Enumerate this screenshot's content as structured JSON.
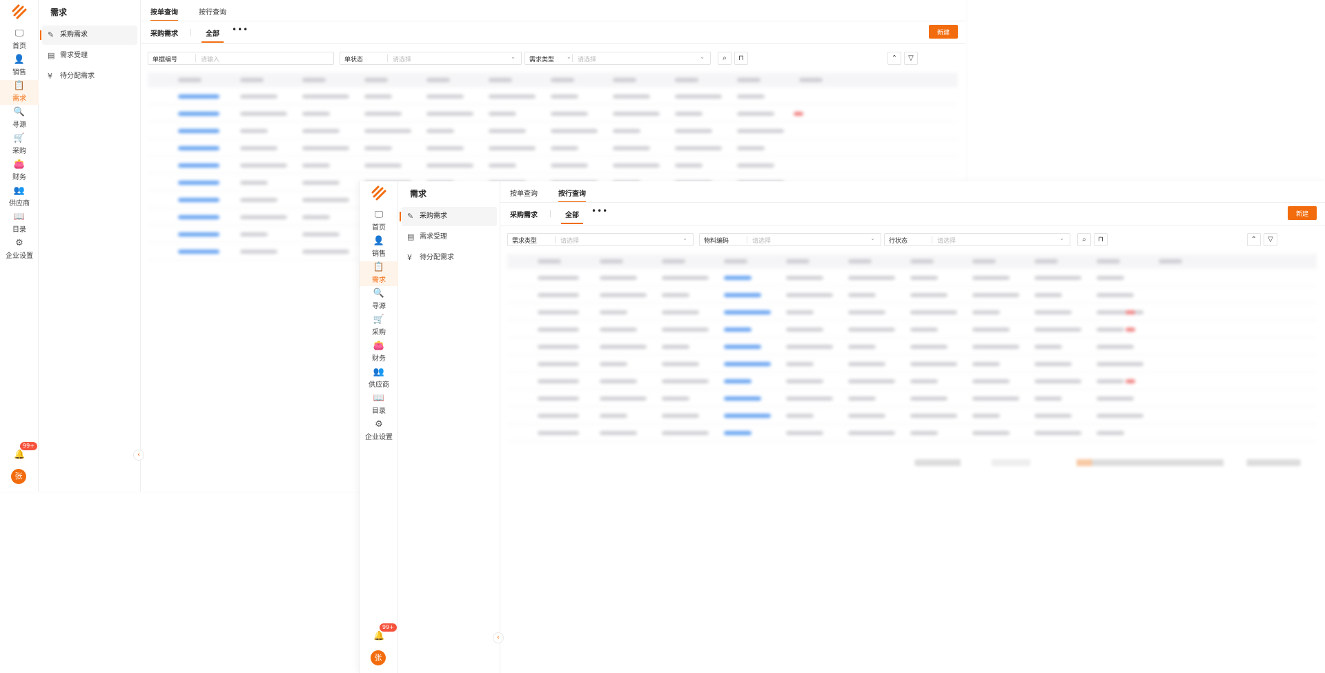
{
  "nav": {
    "items": [
      {
        "label": "首页",
        "icon": "monitor-icon"
      },
      {
        "label": "销售",
        "icon": "person-icon"
      },
      {
        "label": "需求",
        "icon": "clipboard-icon"
      },
      {
        "label": "寻源",
        "icon": "search-icon"
      },
      {
        "label": "采购",
        "icon": "cart-icon"
      },
      {
        "label": "财务",
        "icon": "wallet-icon"
      },
      {
        "label": "供应商",
        "icon": "supplier-icon"
      },
      {
        "label": "目录",
        "icon": "book-icon"
      },
      {
        "label": "企业设置",
        "icon": "settings-icon"
      }
    ],
    "active": "需求",
    "notification_badge": "99+",
    "avatar": "张"
  },
  "sidebar": {
    "title": "需求",
    "items": [
      {
        "label": "采购需求",
        "icon": "edit-icon"
      },
      {
        "label": "需求受理",
        "icon": "document-icon"
      },
      {
        "label": "待分配需求",
        "icon": "yen-icon"
      }
    ],
    "active": "采购需求"
  },
  "tabs": [
    "按单查询",
    "按行查询"
  ],
  "subheader": {
    "title": "采购需求",
    "tab": "全部",
    "more": "•••"
  },
  "new_button": "新建",
  "window1": {
    "active_tab": "按单查询",
    "filters": [
      {
        "label": "单据编号",
        "placeholder": "请输入"
      },
      {
        "label": "单状态",
        "placeholder": "请选择"
      },
      {
        "label": "需求类型",
        "placeholder": "请选择"
      }
    ]
  },
  "window2": {
    "active_tab": "按行查询",
    "filters": [
      {
        "label": "需求类型",
        "placeholder": "请选择"
      },
      {
        "label": "物料编码",
        "placeholder": "请选择"
      },
      {
        "label": "行状态",
        "placeholder": "请选择"
      }
    ]
  },
  "colors": {
    "accent": "#f26c0d",
    "link": "#5b9cf0",
    "danger": "#f07a7a",
    "badge": "#f5533d"
  }
}
